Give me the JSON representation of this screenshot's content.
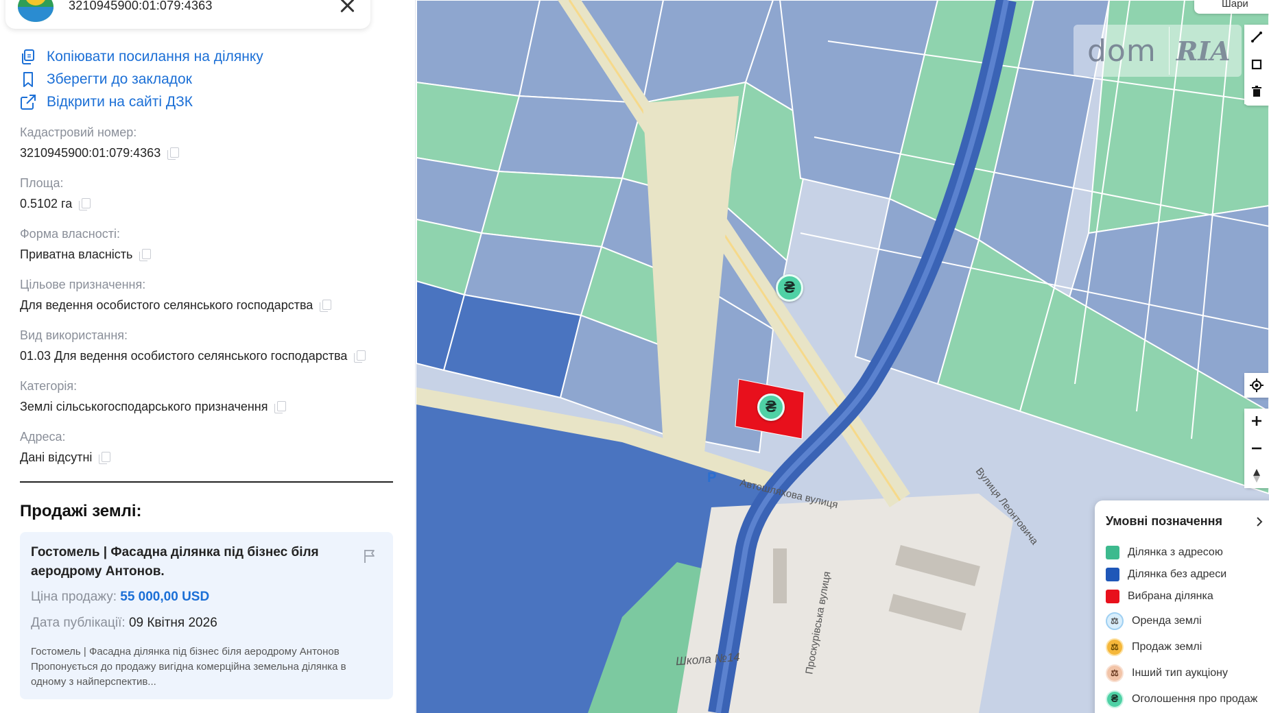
{
  "header": {
    "cadastral_title": "3210945900:01:079:4363"
  },
  "actions": {
    "copy_link": "Копіювати посилання на ділянку",
    "save_bookmark": "Зберегти до закладок",
    "open_dzk": "Відкрити на сайті ДЗК"
  },
  "fields": {
    "cadastral_number": {
      "label": "Кадастровий номер:",
      "value": "3210945900:01:079:4363"
    },
    "area": {
      "label": "Площа:",
      "value": "0.5102 га"
    },
    "ownership": {
      "label": "Форма власності:",
      "value": "Приватна власність"
    },
    "purpose": {
      "label": "Цільове призначення:",
      "value": "Для ведення особистого селянського господарства"
    },
    "usage": {
      "label": "Вид використання:",
      "value": "01.03 Для ведення особистого селянського господарства"
    },
    "category": {
      "label": "Категорія:",
      "value": "Землі сільськогосподарського призначення"
    },
    "address": {
      "label": "Адреса:",
      "value": "Дані відсутні"
    }
  },
  "sales": {
    "title": "Продажі землі:",
    "listing": {
      "name": "Гостомель | Фасадна ділянка під бізнес біля аеродрому Антонов.",
      "price_label": "Ціна продажу:",
      "price_value": "55 000,00 USD",
      "date_label": "Дата публікації:",
      "date_value": "09 Квітня 2026",
      "description": "Гостомель | Фасадна ділянка під бізнес біля аеродрому Антонов Пропонується до продажу вигідна комерційна земельна ділянка в одному з найперспектив..."
    }
  },
  "map": {
    "watermark_left": "dom",
    "watermark_right": "RIA",
    "layer_button": "Шари",
    "marker_symbol": "₴",
    "street_labels": {
      "avtoshliakhova": "Автошляхова вулиця",
      "leontovycha": "Вулиця Леонтовича",
      "proskurivska": "Проскурівська вулиця",
      "school": "Школа №14",
      "parking": "P"
    },
    "legend": {
      "title": "Умовні позначення",
      "items": [
        {
          "label": "Ділянка з адресою",
          "color": "#3dba8e"
        },
        {
          "label": "Ділянка без адреси",
          "color": "#1f57b8"
        },
        {
          "label": "Вибрана ділянка",
          "color": "#e8101c"
        },
        {
          "label": "Оренда землі",
          "color": "#9fd0f2"
        },
        {
          "label": "Продаж землі",
          "color": "#f5b73a"
        },
        {
          "label": "Інший тип аукціону",
          "color": "#f2c4a8"
        },
        {
          "label": "Оголошення про продаж",
          "color": "#4fd1a5"
        }
      ]
    }
  },
  "colors": {
    "link": "#1b6fd6",
    "parcel_blue": "#8ea6cf",
    "parcel_green": "#8fd3ae",
    "parcel_dark": "#4a74c0",
    "selected": "#e8101c"
  }
}
